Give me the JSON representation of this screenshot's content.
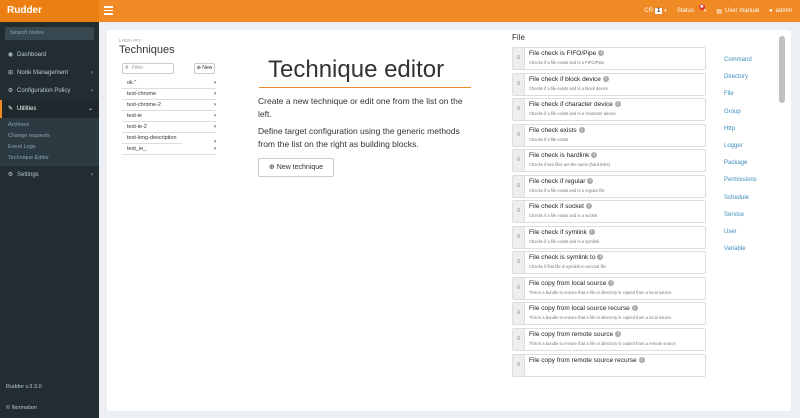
{
  "app": {
    "brand": "Rudder"
  },
  "topbar": {
    "cr_label": "CR",
    "cr_count": "1",
    "status_label": "Status",
    "status_badge": "✖",
    "user_manual": "User manual",
    "user": "admin"
  },
  "sidebar": {
    "search_placeholder": "Search nodes",
    "items": [
      {
        "label": "Dashboard",
        "icon": "dashboard-icon"
      },
      {
        "label": "Node Management",
        "icon": "sitemap-icon"
      },
      {
        "label": "Configuration Policy",
        "icon": "policy-icon"
      },
      {
        "label": "Utilities",
        "icon": "wrench-icon"
      },
      {
        "label": "Settings",
        "icon": "gear-icon"
      }
    ],
    "subitems": [
      "Archives",
      "Change requests",
      "Event Logs",
      "Technique Editor"
    ],
    "version": "Rudder v.3.3.0",
    "copyright": "© Normation"
  },
  "library": {
    "label": "LIBRARY",
    "title": "Techniques",
    "filter_placeholder": "Filter",
    "new_label": "New",
    "techniques": [
      "ok.\"",
      "test-chrome",
      "test-chrome-2",
      "test-ie",
      "test-ie-2",
      "test-long-description",
      "test_ie_"
    ]
  },
  "editor": {
    "title": "Technique editor",
    "p1": "Create a new technique or edit one from the list on the left.",
    "p2": "Define target configuration using the generic methods from the list on the right as building blocks.",
    "new_button": "New technique"
  },
  "methods": {
    "heading": "File",
    "items": [
      {
        "name": "File check is FIFO/Pipe",
        "desc": "Checks if a file exists and is a FIFO/Pipe"
      },
      {
        "name": "File check if block device",
        "desc": "Checks if a file exists and is a block device"
      },
      {
        "name": "File check if character device",
        "desc": "Checks if a file exists and is a character device"
      },
      {
        "name": "File check exists",
        "desc": "Checks if a file exists"
      },
      {
        "name": "File check is hardlink",
        "desc": "Checks if two files are the same (hard links)"
      },
      {
        "name": "File check if regular",
        "desc": "Checks if a file exists and is a regular file"
      },
      {
        "name": "File check if socket",
        "desc": "Checks if a file exists and is a socket"
      },
      {
        "name": "File check if symlink",
        "desc": "Checks if a file exists and is a symlink"
      },
      {
        "name": "File check is symlink to",
        "desc": "Checks if first file is symlink to second file"
      },
      {
        "name": "File copy from local source",
        "desc": "This is a bundle to ensure that a file or directory is copied from a local source"
      },
      {
        "name": "File copy from local source recurse",
        "desc": "This is a bundle to ensure that a file or directory is copied from a local source"
      },
      {
        "name": "File copy from remote source",
        "desc": "This is a bundle to ensure that a file or directory is copied from a remote source"
      },
      {
        "name": "File copy from remote source recurse",
        "desc": ""
      }
    ]
  },
  "categories": [
    "Command",
    "Directory",
    "File",
    "Group",
    "Http",
    "Logger",
    "Package",
    "Permissions",
    "Schedule",
    "Service",
    "User",
    "Variable"
  ]
}
